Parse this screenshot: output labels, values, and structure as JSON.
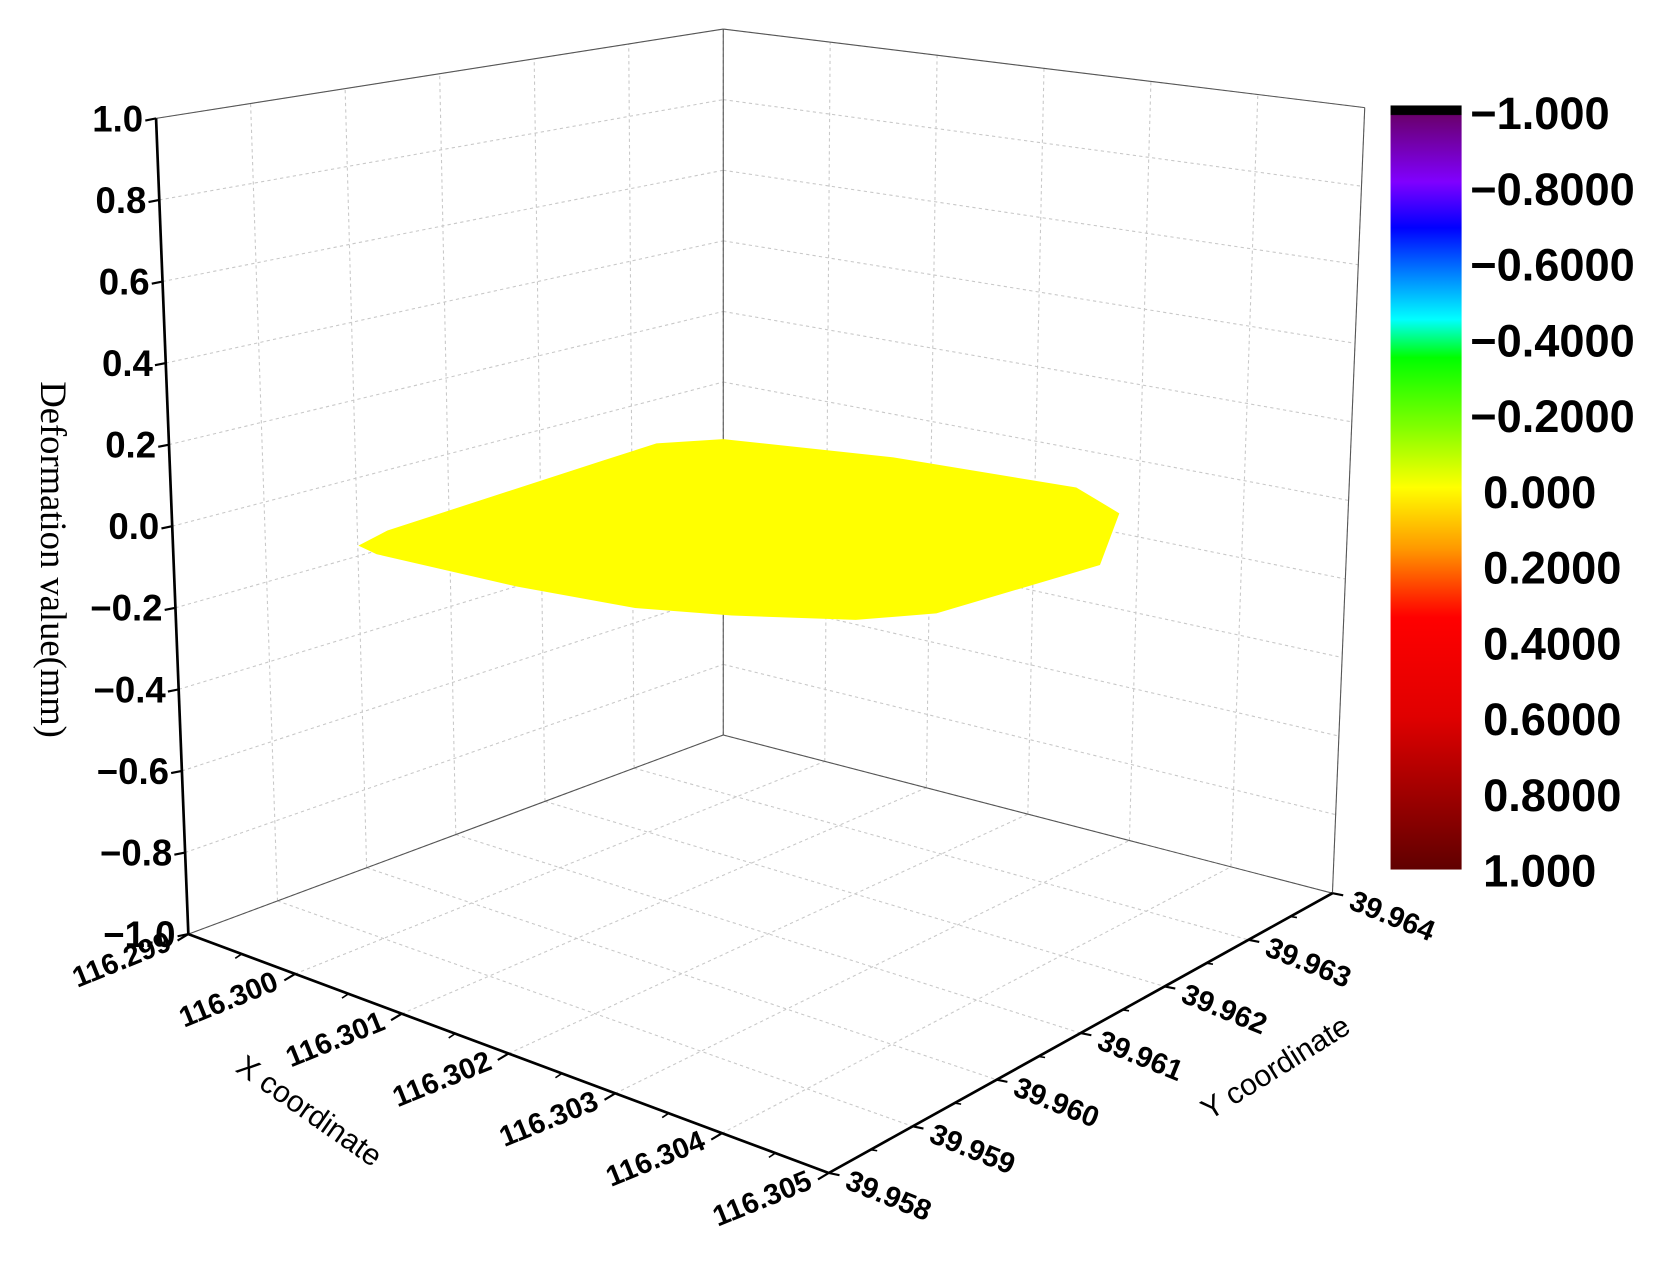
{
  "chart_data": {
    "type": "surface3d",
    "title": "",
    "xlabel": "X coordinate",
    "ylabel": "Y coordinate",
    "zlabel": "Deformation value(mm)",
    "xlim": [
      116.299,
      116.305
    ],
    "ylim": [
      39.958,
      39.964
    ],
    "zlim": [
      -1.0,
      1.0
    ],
    "x_ticks": [
      "116.299",
      "116.300",
      "116.301",
      "116.302",
      "116.303",
      "116.304",
      "116.305"
    ],
    "y_ticks": [
      "39.958",
      "39.959",
      "39.960",
      "39.961",
      "39.962",
      "39.963",
      "39.964"
    ],
    "z_ticks": [
      "1.0",
      "0.8",
      "0.6",
      "0.4",
      "0.2",
      "0.0",
      "−0.2",
      "−0.4",
      "−0.6",
      "−0.8",
      "−1.0"
    ],
    "grid": true,
    "surface": {
      "z_value": 0.0,
      "color": "#ffff00"
    },
    "colorbar": {
      "placement": "right",
      "range": [
        -1.0,
        1.0
      ],
      "labels": [
        "−1.000",
        "−0.8000",
        "−0.6000",
        "−0.4000",
        "−0.2000",
        "0.000",
        "0.2000",
        "0.4000",
        "0.6000",
        "0.8000",
        "1.000"
      ]
    }
  }
}
